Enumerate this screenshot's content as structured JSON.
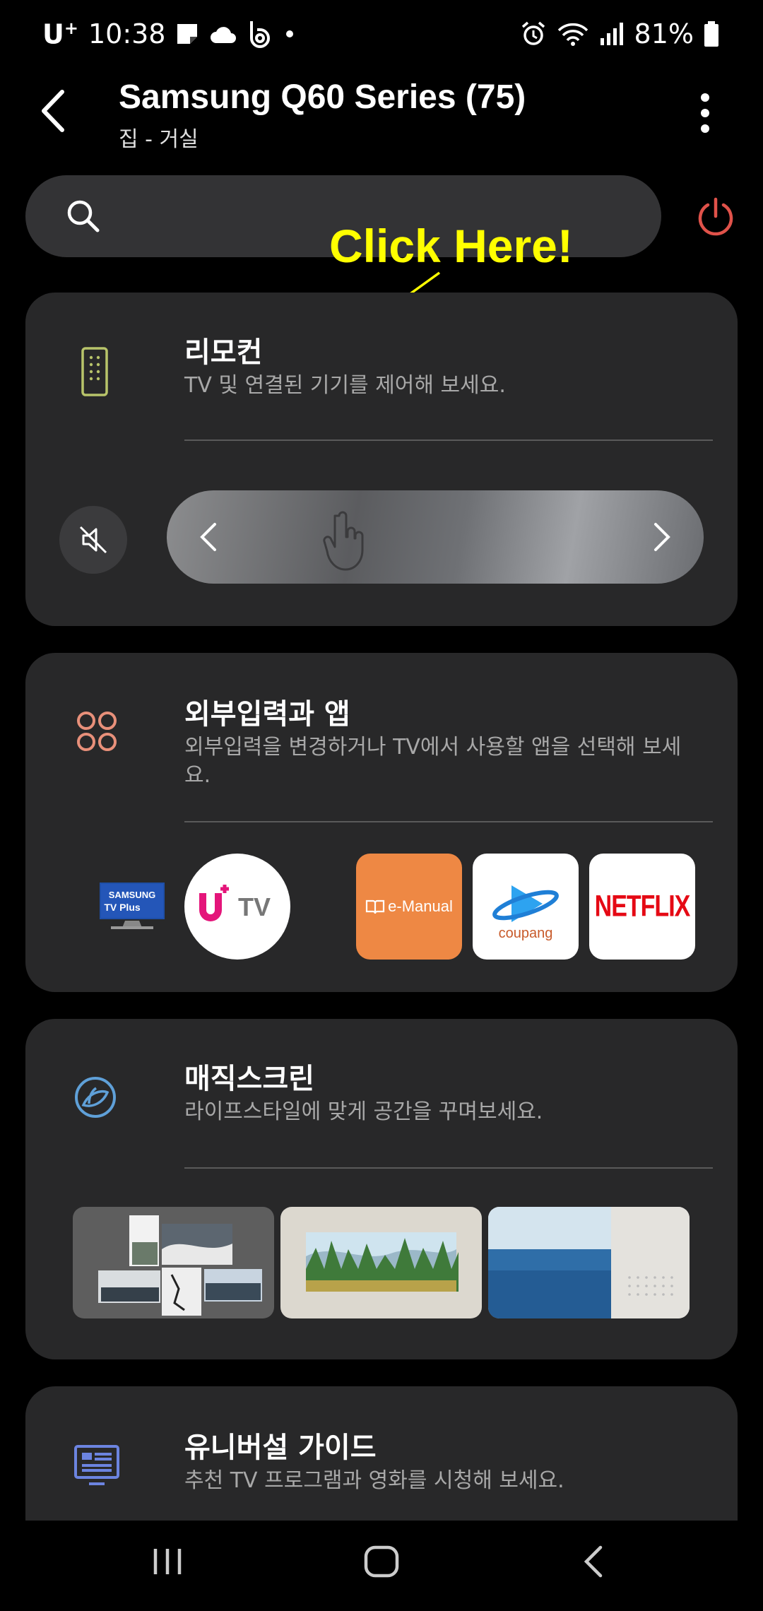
{
  "status": {
    "carrier": "U",
    "carrier_sup": "+",
    "time": "10:38",
    "battery": "81%",
    "icons_left": [
      "memo-icon",
      "cloud-icon",
      "b-icon",
      "dot-icon"
    ],
    "icons_right": [
      "alarm-icon",
      "wifi-icon",
      "signal-icon",
      "battery-icon"
    ]
  },
  "header": {
    "title": "Samsung Q60 Series (75)",
    "subtitle": "집 - 거실"
  },
  "annotation": {
    "text": "Click Here!",
    "color": "#ffff00"
  },
  "cards": {
    "remote": {
      "title": "리모컨",
      "desc": "TV 및 연결된 기기를 제어해 보세요."
    },
    "apps": {
      "title": "외부입력과 앱",
      "desc": "외부입력을 변경하거나 TV에서 사용할 앱을 선택해 보세요.",
      "tiles": {
        "samsung_line1": "SAMSUNG",
        "samsung_line2": "TV Plus",
        "utv": "TV",
        "emanual": "e-Manual",
        "coupang": "coupang",
        "netflix": "NETFLIX"
      }
    },
    "magic": {
      "title": "매직스크린",
      "desc": "라이프스타일에 맞게 공간을 꾸며보세요."
    },
    "guide": {
      "title": "유니버설 가이드",
      "desc": "추천 TV 프로그램과 영화를 시청해 보세요."
    }
  },
  "colors": {
    "background": "#000000",
    "card": "#282829",
    "power": "#e0524a",
    "remote_icon": "#b8c46a",
    "apps_icon": "#e8907a",
    "magic_icon": "#5fa0d8",
    "guide_icon": "#6c84e0"
  }
}
